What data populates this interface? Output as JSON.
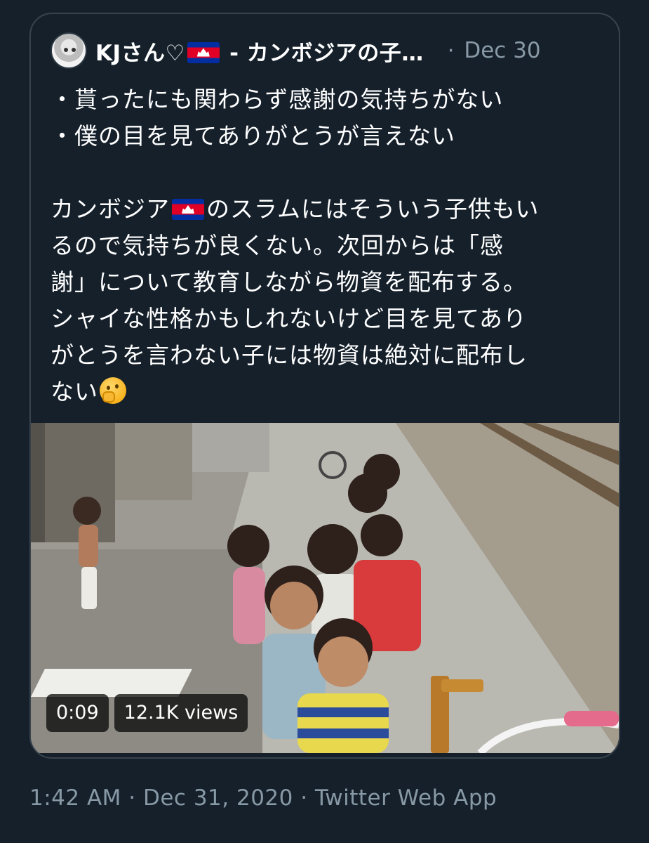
{
  "quoted_tweet": {
    "display_name": "KJさん♡",
    "display_name_suffix": " - カンボジアの子…",
    "separator": "·",
    "date": "Dec 30",
    "lines": {
      "l1": "・貰ったにも関わらず感謝の気持ちがない",
      "l2": "・僕の目を見てありがとうが言えない",
      "l3a": "カンボジア",
      "l3b": "のスラムにはそういう子供もい",
      "l4": "るので気持ちが良くない。次回からは「感",
      "l5": "謝」について教育しながら物資を配布する。",
      "l6": "シャイな性格かもしれないけど目を見てあり",
      "l7": "がとうを言わない子には物資は絶対に配布し",
      "l8": "ない"
    },
    "emoji": "thinking-face",
    "video": {
      "duration": "0:09",
      "views": "12.1K views"
    }
  },
  "meta": {
    "timestamp": "1:42 AM · Dec 31, 2020 · Twitter Web App"
  },
  "colors": {
    "background": "#15202b",
    "border": "#38444d",
    "muted_text": "#8899a6",
    "text": "#ffffff"
  }
}
